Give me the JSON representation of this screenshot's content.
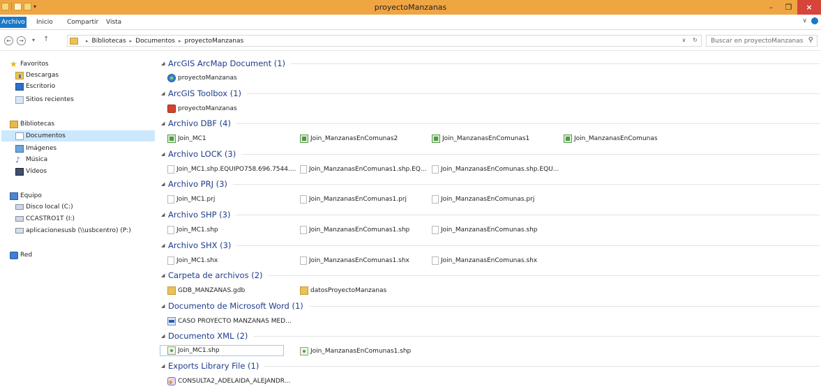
{
  "window": {
    "title": "proyectoManzanas"
  },
  "ribbon": {
    "tabs": [
      "Archivo",
      "Inicio",
      "Compartir",
      "Vista"
    ]
  },
  "address": {
    "breadcrumb": [
      "Bibliotecas",
      "Documentos",
      "proyectoManzanas"
    ],
    "search_placeholder": "Buscar en proyectoManzanas"
  },
  "nav": {
    "favoritos": {
      "label": "Favoritos",
      "items": [
        "Descargas",
        "Escritorio",
        "Sitios recientes"
      ]
    },
    "bibliotecas": {
      "label": "Bibliotecas",
      "items": [
        "Documentos",
        "Imágenes",
        "Música",
        "Vídeos"
      ],
      "selected": "Documentos"
    },
    "equipo": {
      "label": "Equipo",
      "items": [
        "Disco local (C:)",
        "CCASTRO1T (I:)",
        "aplicacionesusb (\\\\usbcentro) (P:)"
      ]
    },
    "red": {
      "label": "Red"
    }
  },
  "groups": [
    {
      "title": "ArcGIS ArcMap Document (1)",
      "icon": "mxd-icon",
      "items": [
        "proyectoManzanas"
      ]
    },
    {
      "title": "ArcGIS Toolbox (1)",
      "icon": "toolbox-icon",
      "items": [
        "proyectoManzanas"
      ]
    },
    {
      "title": "Archivo DBF (4)",
      "icon": "dbf-icon",
      "items": [
        "Join_MC1",
        "Join_ManzanasEnComunas2",
        "Join_ManzanasEnComunas1",
        "Join_ManzanasEnComunas"
      ]
    },
    {
      "title": "Archivo LOCK (3)",
      "icon": "blank-file-icon",
      "items": [
        "Join_MC1.shp.EQUIPO758.696.7544....",
        "Join_ManzanasEnComunas1.shp.EQ...",
        "Join_ManzanasEnComunas.shp.EQU..."
      ]
    },
    {
      "title": "Archivo PRJ (3)",
      "icon": "blank-file-icon",
      "items": [
        "Join_MC1.prj",
        "Join_ManzanasEnComunas1.prj",
        "Join_ManzanasEnComunas.prj"
      ]
    },
    {
      "title": "Archivo SHP (3)",
      "icon": "blank-file-icon",
      "items": [
        "Join_MC1.shp",
        "Join_ManzanasEnComunas1.shp",
        "Join_ManzanasEnComunas.shp"
      ]
    },
    {
      "title": "Archivo SHX (3)",
      "icon": "blank-file-icon",
      "items": [
        "Join_MC1.shx",
        "Join_ManzanasEnComunas1.shx",
        "Join_ManzanasEnComunas.shx"
      ]
    },
    {
      "title": "Carpeta de archivos (2)",
      "icon": "folder-icon",
      "items": [
        "GDB_MANZANAS.gdb",
        "datosProyectoManzanas"
      ]
    },
    {
      "title": "Documento de Microsoft Word (1)",
      "icon": "word-doc-icon",
      "items": [
        "CASO PROYECTO MANZANAS MED..."
      ]
    },
    {
      "title": "Documento XML (2)",
      "icon": "xml-file-icon",
      "items": [
        "Join_MC1.shp",
        "Join_ManzanasEnComunas1.shp"
      ]
    },
    {
      "title": "Exports Library File (1)",
      "icon": "exports-library-icon",
      "items": [
        "CONSULTA2_ADELAIDA_ALEJANDR..."
      ]
    }
  ]
}
